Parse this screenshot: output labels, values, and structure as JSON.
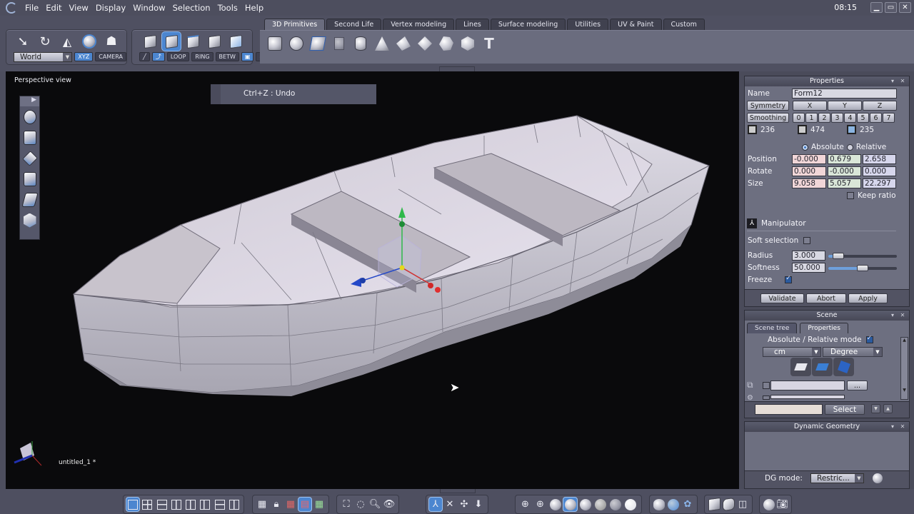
{
  "menubar": {
    "items": [
      "File",
      "Edit",
      "View",
      "Display",
      "Window",
      "Selection",
      "Tools",
      "Help"
    ],
    "clock": "08:15",
    "window_buttons": [
      "minimize",
      "maximize",
      "close"
    ]
  },
  "toolbar": {
    "transform_tools": [
      "select-arrow-icon",
      "rotate-icon",
      "scale-icon",
      "sphere-tool-icon",
      "ghost-icon"
    ],
    "space_select": {
      "value": "World"
    },
    "space_buttons": [
      {
        "label": "XYZ",
        "active": true
      },
      {
        "label": "CAMERA",
        "active": false
      }
    ],
    "selection_modes": [
      "object-mode",
      "face-mode",
      "edge-mode",
      "vertex-mode",
      "mixed-mode"
    ],
    "active_selection_mode": 1,
    "selection_helpers": [
      {
        "label": "LOOP"
      },
      {
        "label": "RING"
      },
      {
        "label": "BETW"
      }
    ],
    "tabs": [
      {
        "label": "3D Primitives",
        "active": true
      },
      {
        "label": "Second Life",
        "active": false
      },
      {
        "label": "Vertex modeling",
        "active": false
      },
      {
        "label": "Lines",
        "active": false
      },
      {
        "label": "Surface modeling",
        "active": false
      },
      {
        "label": "Utilities",
        "active": false
      },
      {
        "label": "UV & Paint",
        "active": false
      },
      {
        "label": "Custom",
        "active": false
      }
    ],
    "primitives": [
      "cube",
      "sphere",
      "plane",
      "grid",
      "cylinder",
      "cone",
      "pyramid",
      "octahedron",
      "dodecahedron",
      "icosahedron",
      "text"
    ]
  },
  "viewport": {
    "label": "Perspective view",
    "undo_hint": "Ctrl+Z : Undo",
    "document_name": "untitled_1 *",
    "side_tools": [
      "select-icon",
      "paint-select-icon",
      "extrude-icon",
      "bevel-icon",
      "bridge-icon",
      "smooth-icon"
    ]
  },
  "properties": {
    "title": "Properties",
    "name_label": "Name",
    "name_value": "Form12",
    "symmetry_label": "Symmetry",
    "symmetry_axes": [
      "X",
      "Y",
      "Z"
    ],
    "smoothing_label": "Smoothing",
    "smoothing_levels": [
      "0",
      "1",
      "2",
      "3",
      "4",
      "5",
      "6",
      "7"
    ],
    "counts": [
      {
        "icon": "vertex-count-icon",
        "value": "236"
      },
      {
        "icon": "edge-count-icon",
        "value": "474"
      },
      {
        "icon": "face-count-icon",
        "value": "235"
      }
    ],
    "mode_absolute": "Absolute",
    "mode_relative": "Relative",
    "mode_selected": "Absolute",
    "rows": [
      {
        "label": "Position",
        "x": "-0.000",
        "y": "0.679",
        "z": "2.658"
      },
      {
        "label": "Rotate",
        "x": "0.000",
        "y": "-0.000",
        "z": "0.000"
      },
      {
        "label": "Size",
        "x": "9.058",
        "y": "5.057",
        "z": "22.297"
      }
    ],
    "keep_ratio_label": "Keep ratio",
    "keep_ratio": false,
    "manipulator_label": "Manipulator",
    "soft_selection_label": "Soft selection",
    "soft_selection": false,
    "radius_label": "Radius",
    "radius_value": "3.000",
    "radius_slider": 0.15,
    "softness_label": "Softness",
    "softness_value": "50.000",
    "softness_slider": 0.5,
    "freeze_label": "Freeze",
    "freeze": true,
    "buttons": [
      "Validate",
      "Abort",
      "Apply"
    ]
  },
  "scene": {
    "title": "Scene",
    "tabs": [
      {
        "label": "Scene tree",
        "active": false
      },
      {
        "label": "Properties",
        "active": true
      }
    ],
    "abs_rel_label": "Absolute / Relative mode",
    "abs_rel_checked": true,
    "unit_value": "cm",
    "angle_value": "Degree",
    "select_button": "Select",
    "ellipsis": "..."
  },
  "dynamic_geometry": {
    "title": "Dynamic Geometry",
    "mode_label": "DG mode:",
    "mode_value": "Restric..."
  },
  "bottombar": {
    "layout_buttons": 8,
    "active_layout": 0
  }
}
